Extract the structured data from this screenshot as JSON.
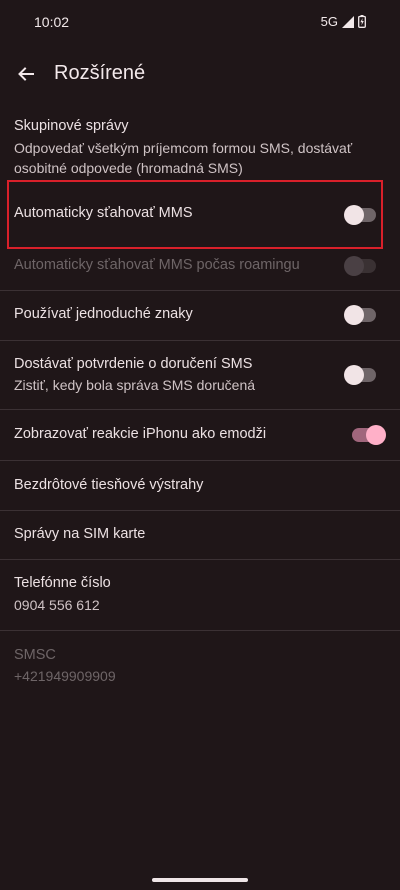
{
  "status_bar": {
    "time": "10:02",
    "network": "5G"
  },
  "header": {
    "title": "Rozšírené",
    "back_icon": "arrow-back-icon"
  },
  "preferences": [
    {
      "title": "Skupinové správy",
      "summary": "Odpovedať všetkým príjemcom formou SMS, dostávať osobitné odpovede (hromadná SMS)"
    },
    {
      "title": "Automaticky sťahovať MMS",
      "switch": "off"
    },
    {
      "title": "Automaticky sťahovať MMS počas roamingu",
      "switch": "off",
      "disabled": true
    },
    {
      "title": "Používať jednoduché znaky",
      "switch": "off"
    },
    {
      "title": "Dostávať potvrdenie o doručení SMS",
      "summary": "Zistiť, kedy bola správa SMS doručená",
      "switch": "off"
    },
    {
      "title": "Zobrazovať reakcie iPhonu ako emodži",
      "switch": "on"
    },
    {
      "title": "Bezdrôtové tiesňové výstrahy"
    },
    {
      "title": "Správy na SIM karte"
    },
    {
      "title": "Telefónne číslo",
      "summary": "0904 556 612"
    },
    {
      "title": "SMSC",
      "summary": "+421949909909",
      "disabled": true
    }
  ],
  "colors": {
    "background": "#1f1618",
    "accent": "#ffb0c8",
    "highlight": "#d9202a"
  }
}
